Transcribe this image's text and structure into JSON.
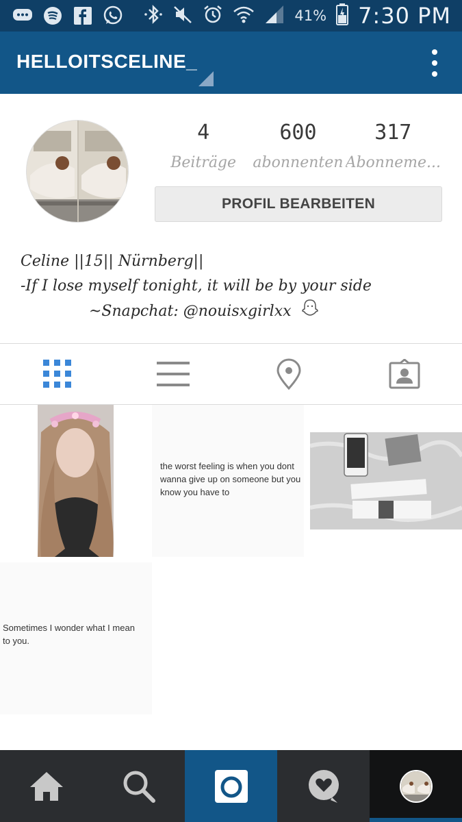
{
  "status_bar": {
    "battery_percent": "41%",
    "time": "7:30 PM",
    "icons": [
      "message-icon",
      "spotify-icon",
      "facebook-icon",
      "whatsapp-icon",
      "bluetooth-icon",
      "mute-icon",
      "alarm-icon",
      "wifi-icon",
      "signal-icon",
      "battery-icon"
    ]
  },
  "header": {
    "username": "HELLOITSCELINE_"
  },
  "profile": {
    "stats": [
      {
        "value": "4",
        "label": "Beiträge"
      },
      {
        "value": "600",
        "label": "abonnenten"
      },
      {
        "value": "317",
        "label": "Abonneme..."
      }
    ],
    "edit_button": "PROFIL BEARBEITEN",
    "bio": {
      "line1": "Celine ||15|| Nürnberg||",
      "line2": "-If I lose myself tonight, it will be by your side",
      "line3": "~Snapchat: @nouisxgirlxx"
    }
  },
  "tabs": [
    "grid-view-icon",
    "list-view-icon",
    "location-pin-icon",
    "tagged-photos-icon"
  ],
  "posts": [
    {
      "type": "photo",
      "name": "post-selfie"
    },
    {
      "type": "text",
      "text": "the worst feeling is when you dont wanna give up on someone but you know you have to"
    },
    {
      "type": "photo",
      "name": "post-concert-tickets"
    },
    {
      "type": "text",
      "text": "Sometimes I wonder what I mean to you."
    }
  ],
  "bottom_nav": [
    "home-icon",
    "search-icon",
    "camera-icon",
    "activity-heart-icon",
    "profile-avatar"
  ],
  "colors": {
    "status_bar": "#0f3f66",
    "app_bar": "#125688",
    "bottom_nav": "#2b2d30",
    "active_tab": "#3b87d8"
  }
}
